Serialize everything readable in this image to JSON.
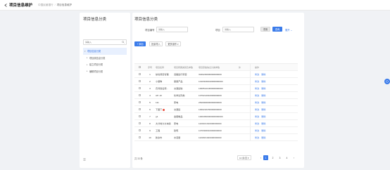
{
  "header": {
    "title": "项目信息维护",
    "breadcrumb": [
      "中国民营银行",
      "项目信息维护"
    ]
  },
  "tree": {
    "title": "项目信息分类",
    "search_placeholder": "请输入",
    "items": [
      {
        "label": "项目信息分类",
        "selected": true,
        "child": false
      },
      {
        "label": "项目原信息分类",
        "selected": false,
        "child": true
      },
      {
        "label": "建立项目分类",
        "selected": false,
        "child": true
      },
      {
        "label": "编辑项目分类",
        "selected": false,
        "child": true
      }
    ]
  },
  "main": {
    "title": "项目信息分类",
    "filters": {
      "code_label": "项目编号",
      "code_placeholder": "请输入",
      "name_label": "项目",
      "name_placeholder": "请输入"
    },
    "buttons": {
      "reset": "重置",
      "query": "查询",
      "expand": "展开",
      "add": "+ 添加",
      "batch_import": "批量导入",
      "more": "更多操作"
    },
    "columns": [
      "序号",
      "项目名称",
      "项目所属类别及参数",
      "项目原始信息分类参数",
      "外",
      "操作"
    ],
    "rows": [
      {
        "idx": "1",
        "name": "禁毒项目管理",
        "type": "道路运行项目",
        "code": "3040230000000000000",
        "ops": [
          "修改",
          "删除"
        ]
      },
      {
        "idx": "2",
        "name": "小量降",
        "type": "量量产品",
        "code": "10103030010000000000",
        "ops": [
          "修改",
          "删除"
        ]
      },
      {
        "idx": "3",
        "name": "农养建设项...",
        "type": "交通运输",
        "code": "10005121000000000000",
        "ops": [
          "修改",
          "删除"
        ]
      },
      {
        "idx": "4",
        "name": "AP..10",
        "type": "化学试剂类",
        "code": "1070214010000000000",
        "ops": [
          "修改",
          "删除"
        ]
      },
      {
        "idx": "5",
        "name": "111",
        "type": "家电",
        "code": "2520000000000000000",
        "ops": [
          "修改",
          "删除"
        ]
      },
      {
        "idx": "6",
        "name": "下面下",
        "type": "交通运",
        "code": "1000210150000000000",
        "ops": [
          "修改",
          "删除"
        ],
        "badge": true
      },
      {
        "idx": "7",
        "name": "g1",
        "type": "金属制品",
        "code": "10004500000000000000",
        "ops": [
          "修改",
          "删除"
        ]
      },
      {
        "idx": "8",
        "name": "大分地力大车版",
        "type": "家电",
        "code": "1100101010000000000",
        "ops": [
          "修改",
          "删除"
        ]
      },
      {
        "idx": "9",
        "name": "工程",
        "type": "建筑",
        "code": "1070300010000000000",
        "ops": [
          "修改",
          "删除"
        ]
      },
      {
        "idx": "10",
        "name": "新余市",
        "type": "水泥量",
        "code": "1100301020000000000",
        "ops": [
          "修改",
          "删除"
        ]
      }
    ],
    "pagination": {
      "total": "共 33 条",
      "size": "10 条/页",
      "pages": [
        "1",
        "2",
        "3",
        "4"
      ],
      "current": "1"
    }
  }
}
